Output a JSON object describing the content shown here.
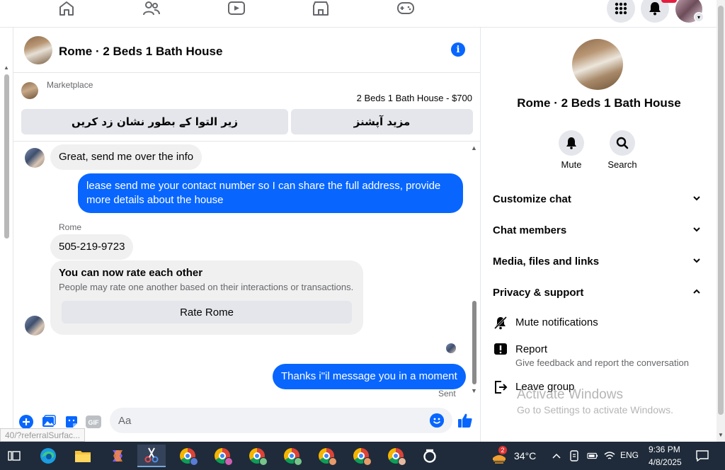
{
  "nav": {
    "icons": [
      "home-icon",
      "friends-icon",
      "video-icon",
      "marketplace-icon",
      "gaming-icon"
    ],
    "right_icons": [
      "menu-grid-icon",
      "notifications-bell-icon",
      "profile-avatar"
    ]
  },
  "chat": {
    "title": "Rome · 2 Beds 1 Bath House",
    "marketplace": {
      "label": "Marketplace",
      "listing": "2 Beds 1 Bath House - $700",
      "btn_mark": "زیر التوا کے بطور نشان زد کریں",
      "btn_more": "مزید آپشنز"
    },
    "messages": {
      "m1": "Great, send me over the info",
      "m2": "lease send me your contact number so I can share the full address, provide more details about the house",
      "sender": "Rome",
      "m3": "505-219-9723",
      "rate_title": "You can now rate each other",
      "rate_sub": "People may rate one another based on their interactions or transactions.",
      "rate_btn": "Rate Rome",
      "m4": "Thanks i\"il message you in a moment",
      "status": "Sent"
    },
    "composer": {
      "placeholder": "Aa",
      "gif_label": "GIF"
    },
    "status_url": "40/?referralSurfac..."
  },
  "details": {
    "title": "Rome · 2 Beds 1 Bath House",
    "mute_label": "Mute",
    "search_label": "Search",
    "rows": {
      "customize": "Customize chat",
      "members": "Chat members",
      "media": "Media, files and links",
      "privacy": "Privacy & support"
    },
    "mute_notifications": "Mute notifications",
    "report": "Report",
    "report_desc": "Give feedback and report the conversation",
    "leave": "Leave group"
  },
  "watermark": {
    "line1": "Activate Windows",
    "line2": "Go to Settings to activate Windows."
  },
  "taskbar": {
    "weather_badge": "2",
    "temperature": "34°C",
    "lang": "ENG",
    "time": "9:36 PM",
    "date": "4/8/2025"
  },
  "colors": {
    "accent": "#0866ff",
    "bubble_in": "#f0f0f0",
    "taskbar": "#1f2b3a"
  }
}
